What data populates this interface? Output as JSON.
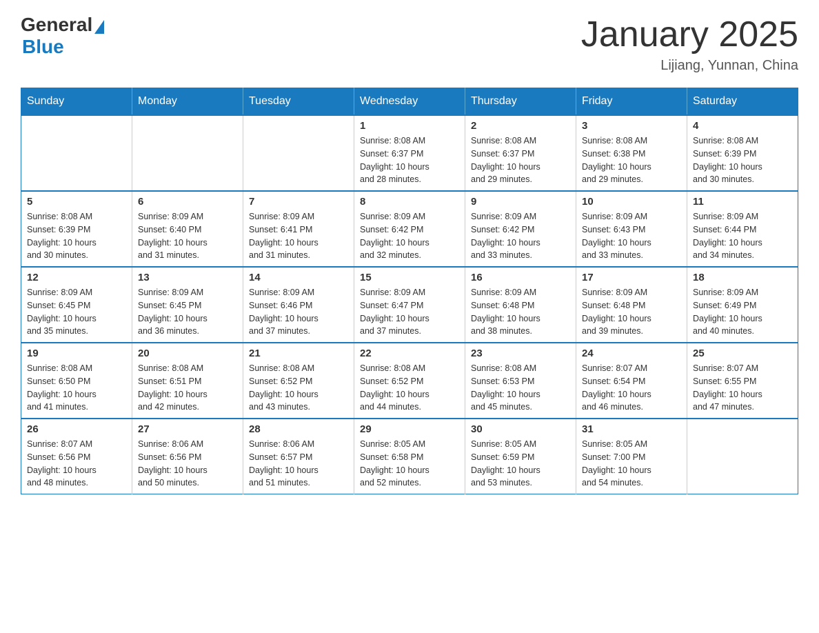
{
  "logo": {
    "general": "General",
    "blue": "Blue"
  },
  "title": "January 2025",
  "location": "Lijiang, Yunnan, China",
  "days_of_week": [
    "Sunday",
    "Monday",
    "Tuesday",
    "Wednesday",
    "Thursday",
    "Friday",
    "Saturday"
  ],
  "weeks": [
    [
      {
        "day": "",
        "info": ""
      },
      {
        "day": "",
        "info": ""
      },
      {
        "day": "",
        "info": ""
      },
      {
        "day": "1",
        "info": "Sunrise: 8:08 AM\nSunset: 6:37 PM\nDaylight: 10 hours\nand 28 minutes."
      },
      {
        "day": "2",
        "info": "Sunrise: 8:08 AM\nSunset: 6:37 PM\nDaylight: 10 hours\nand 29 minutes."
      },
      {
        "day": "3",
        "info": "Sunrise: 8:08 AM\nSunset: 6:38 PM\nDaylight: 10 hours\nand 29 minutes."
      },
      {
        "day": "4",
        "info": "Sunrise: 8:08 AM\nSunset: 6:39 PM\nDaylight: 10 hours\nand 30 minutes."
      }
    ],
    [
      {
        "day": "5",
        "info": "Sunrise: 8:08 AM\nSunset: 6:39 PM\nDaylight: 10 hours\nand 30 minutes."
      },
      {
        "day": "6",
        "info": "Sunrise: 8:09 AM\nSunset: 6:40 PM\nDaylight: 10 hours\nand 31 minutes."
      },
      {
        "day": "7",
        "info": "Sunrise: 8:09 AM\nSunset: 6:41 PM\nDaylight: 10 hours\nand 31 minutes."
      },
      {
        "day": "8",
        "info": "Sunrise: 8:09 AM\nSunset: 6:42 PM\nDaylight: 10 hours\nand 32 minutes."
      },
      {
        "day": "9",
        "info": "Sunrise: 8:09 AM\nSunset: 6:42 PM\nDaylight: 10 hours\nand 33 minutes."
      },
      {
        "day": "10",
        "info": "Sunrise: 8:09 AM\nSunset: 6:43 PM\nDaylight: 10 hours\nand 33 minutes."
      },
      {
        "day": "11",
        "info": "Sunrise: 8:09 AM\nSunset: 6:44 PM\nDaylight: 10 hours\nand 34 minutes."
      }
    ],
    [
      {
        "day": "12",
        "info": "Sunrise: 8:09 AM\nSunset: 6:45 PM\nDaylight: 10 hours\nand 35 minutes."
      },
      {
        "day": "13",
        "info": "Sunrise: 8:09 AM\nSunset: 6:45 PM\nDaylight: 10 hours\nand 36 minutes."
      },
      {
        "day": "14",
        "info": "Sunrise: 8:09 AM\nSunset: 6:46 PM\nDaylight: 10 hours\nand 37 minutes."
      },
      {
        "day": "15",
        "info": "Sunrise: 8:09 AM\nSunset: 6:47 PM\nDaylight: 10 hours\nand 37 minutes."
      },
      {
        "day": "16",
        "info": "Sunrise: 8:09 AM\nSunset: 6:48 PM\nDaylight: 10 hours\nand 38 minutes."
      },
      {
        "day": "17",
        "info": "Sunrise: 8:09 AM\nSunset: 6:48 PM\nDaylight: 10 hours\nand 39 minutes."
      },
      {
        "day": "18",
        "info": "Sunrise: 8:09 AM\nSunset: 6:49 PM\nDaylight: 10 hours\nand 40 minutes."
      }
    ],
    [
      {
        "day": "19",
        "info": "Sunrise: 8:08 AM\nSunset: 6:50 PM\nDaylight: 10 hours\nand 41 minutes."
      },
      {
        "day": "20",
        "info": "Sunrise: 8:08 AM\nSunset: 6:51 PM\nDaylight: 10 hours\nand 42 minutes."
      },
      {
        "day": "21",
        "info": "Sunrise: 8:08 AM\nSunset: 6:52 PM\nDaylight: 10 hours\nand 43 minutes."
      },
      {
        "day": "22",
        "info": "Sunrise: 8:08 AM\nSunset: 6:52 PM\nDaylight: 10 hours\nand 44 minutes."
      },
      {
        "day": "23",
        "info": "Sunrise: 8:08 AM\nSunset: 6:53 PM\nDaylight: 10 hours\nand 45 minutes."
      },
      {
        "day": "24",
        "info": "Sunrise: 8:07 AM\nSunset: 6:54 PM\nDaylight: 10 hours\nand 46 minutes."
      },
      {
        "day": "25",
        "info": "Sunrise: 8:07 AM\nSunset: 6:55 PM\nDaylight: 10 hours\nand 47 minutes."
      }
    ],
    [
      {
        "day": "26",
        "info": "Sunrise: 8:07 AM\nSunset: 6:56 PM\nDaylight: 10 hours\nand 48 minutes."
      },
      {
        "day": "27",
        "info": "Sunrise: 8:06 AM\nSunset: 6:56 PM\nDaylight: 10 hours\nand 50 minutes."
      },
      {
        "day": "28",
        "info": "Sunrise: 8:06 AM\nSunset: 6:57 PM\nDaylight: 10 hours\nand 51 minutes."
      },
      {
        "day": "29",
        "info": "Sunrise: 8:05 AM\nSunset: 6:58 PM\nDaylight: 10 hours\nand 52 minutes."
      },
      {
        "day": "30",
        "info": "Sunrise: 8:05 AM\nSunset: 6:59 PM\nDaylight: 10 hours\nand 53 minutes."
      },
      {
        "day": "31",
        "info": "Sunrise: 8:05 AM\nSunset: 7:00 PM\nDaylight: 10 hours\nand 54 minutes."
      },
      {
        "day": "",
        "info": ""
      }
    ]
  ]
}
